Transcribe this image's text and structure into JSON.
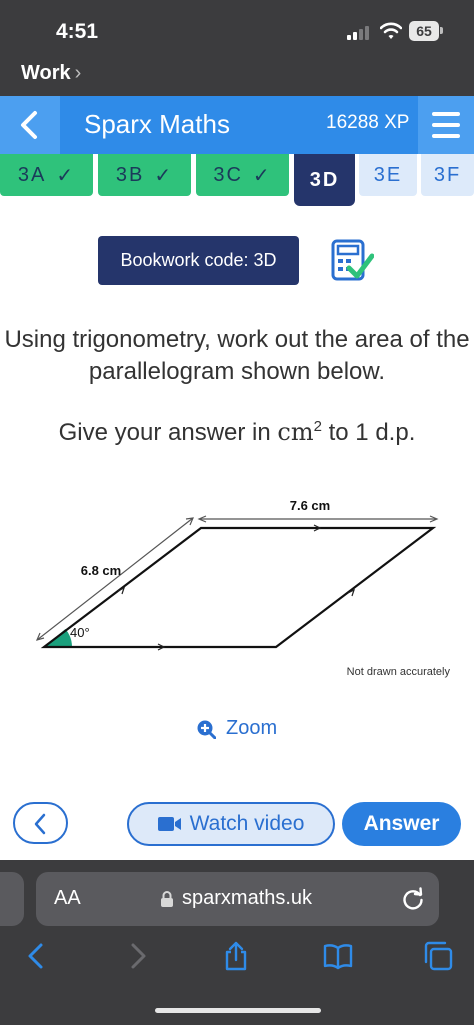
{
  "status_bar": {
    "time": "4:51",
    "battery": "65"
  },
  "back_app": {
    "label": "Work",
    "chevron": "›"
  },
  "header": {
    "title": "Sparx Maths",
    "xp": "16288 XP"
  },
  "tabs": [
    {
      "label": "3A",
      "state": "done"
    },
    {
      "label": "3B",
      "state": "done"
    },
    {
      "label": "3C",
      "state": "done"
    },
    {
      "label": "3D",
      "state": "current"
    },
    {
      "label": "3E",
      "state": "todo"
    },
    {
      "label": "3F",
      "state": "todo"
    }
  ],
  "tick_glyph": "✓",
  "main": {
    "bookwork_code": "Bookwork code: 3D",
    "question": "Using trigonometry, work out the area of the parallelogram shown below.",
    "give_prefix": "Give your answer in",
    "give_unit": "cm",
    "give_exponent": "2",
    "give_suffix": "to 1 d.p.",
    "figure": {
      "top_side": "7.6 cm",
      "left_side": "6.8 cm",
      "angle": "40°",
      "note": "Not drawn accurately"
    },
    "zoom_label": "Zoom"
  },
  "actions": {
    "watch_video": "Watch video",
    "answer": "Answer"
  },
  "safari": {
    "text_size": "AA",
    "url": "sparxmaths.uk"
  },
  "icons": {
    "status": [
      "signal-icon",
      "wifi-icon",
      "battery-icon"
    ],
    "header": [
      "back-arrow-icon",
      "menu-icon"
    ],
    "main": [
      "calculator-check-icon",
      "zoom-plus-icon"
    ],
    "actions": [
      "back-arrow-icon",
      "video-camera-icon"
    ],
    "safari": [
      "lock-icon",
      "reload-icon",
      "back-icon",
      "forward-icon",
      "share-icon",
      "bookmarks-icon",
      "tabs-icon"
    ]
  },
  "colors": {
    "sparx_blue": "#2f8be8",
    "tab_done": "#2fc27b",
    "tab_current": "#25356b",
    "tab_todo": "#ddeafa",
    "angle_fill": "#1a9f7c",
    "button_blue": "#2a7fe0"
  }
}
